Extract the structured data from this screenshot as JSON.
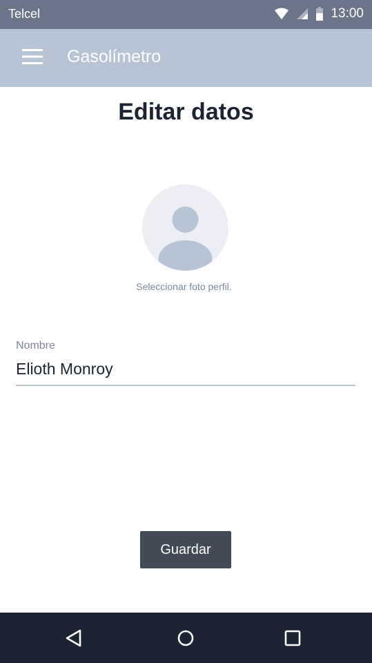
{
  "status_bar": {
    "carrier": "Telcel",
    "time": "13:00",
    "icons": [
      "wifi-icon",
      "signal-icon",
      "battery-icon"
    ]
  },
  "app_bar": {
    "title": "Gasolímetro",
    "menu_icon": "hamburger-menu-icon"
  },
  "main": {
    "title": "Editar datos",
    "avatar": {
      "icon": "person-placeholder-icon",
      "caption": "Seleccionar foto perfil."
    },
    "name_field": {
      "label": "Nombre",
      "value": "Elioth Monroy"
    },
    "save_button": {
      "label": "Guardar"
    }
  },
  "nav_bar": {
    "icons": [
      "back-triangle-icon",
      "home-circle-icon",
      "recent-apps-square-icon"
    ]
  },
  "colors": {
    "status_bar": "#6b7488",
    "app_bar": "#b6c4d6",
    "title_text": "#1c2433",
    "secondary_text": "#7c88a3",
    "button": "#414a55",
    "nav_bar": "#1c2433",
    "avatar_bg": "#eceef3",
    "avatar_figure": "#b6c4d6"
  }
}
